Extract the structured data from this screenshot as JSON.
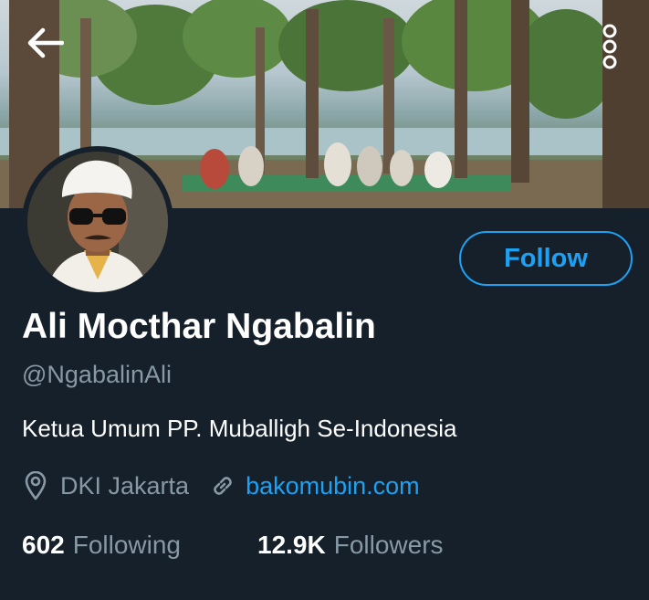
{
  "header": {
    "back_icon": "arrow-left-icon",
    "more_icon": "more-vertical-icon"
  },
  "profile": {
    "display_name": "Ali Mocthar Ngabalin",
    "handle": "@NgabalinAli",
    "bio": "Ketua Umum PP. Muballigh Se-Indonesia",
    "location": "DKI Jakarta",
    "website": "bakomubin.com",
    "follow_label": "Follow"
  },
  "stats": {
    "following_count": "602",
    "following_label": "Following",
    "followers_count": "12.9K",
    "followers_label": "Followers"
  },
  "colors": {
    "background": "#15202b",
    "accent": "#1da1f2",
    "text_primary": "#ffffff",
    "text_secondary": "#8899a6"
  }
}
